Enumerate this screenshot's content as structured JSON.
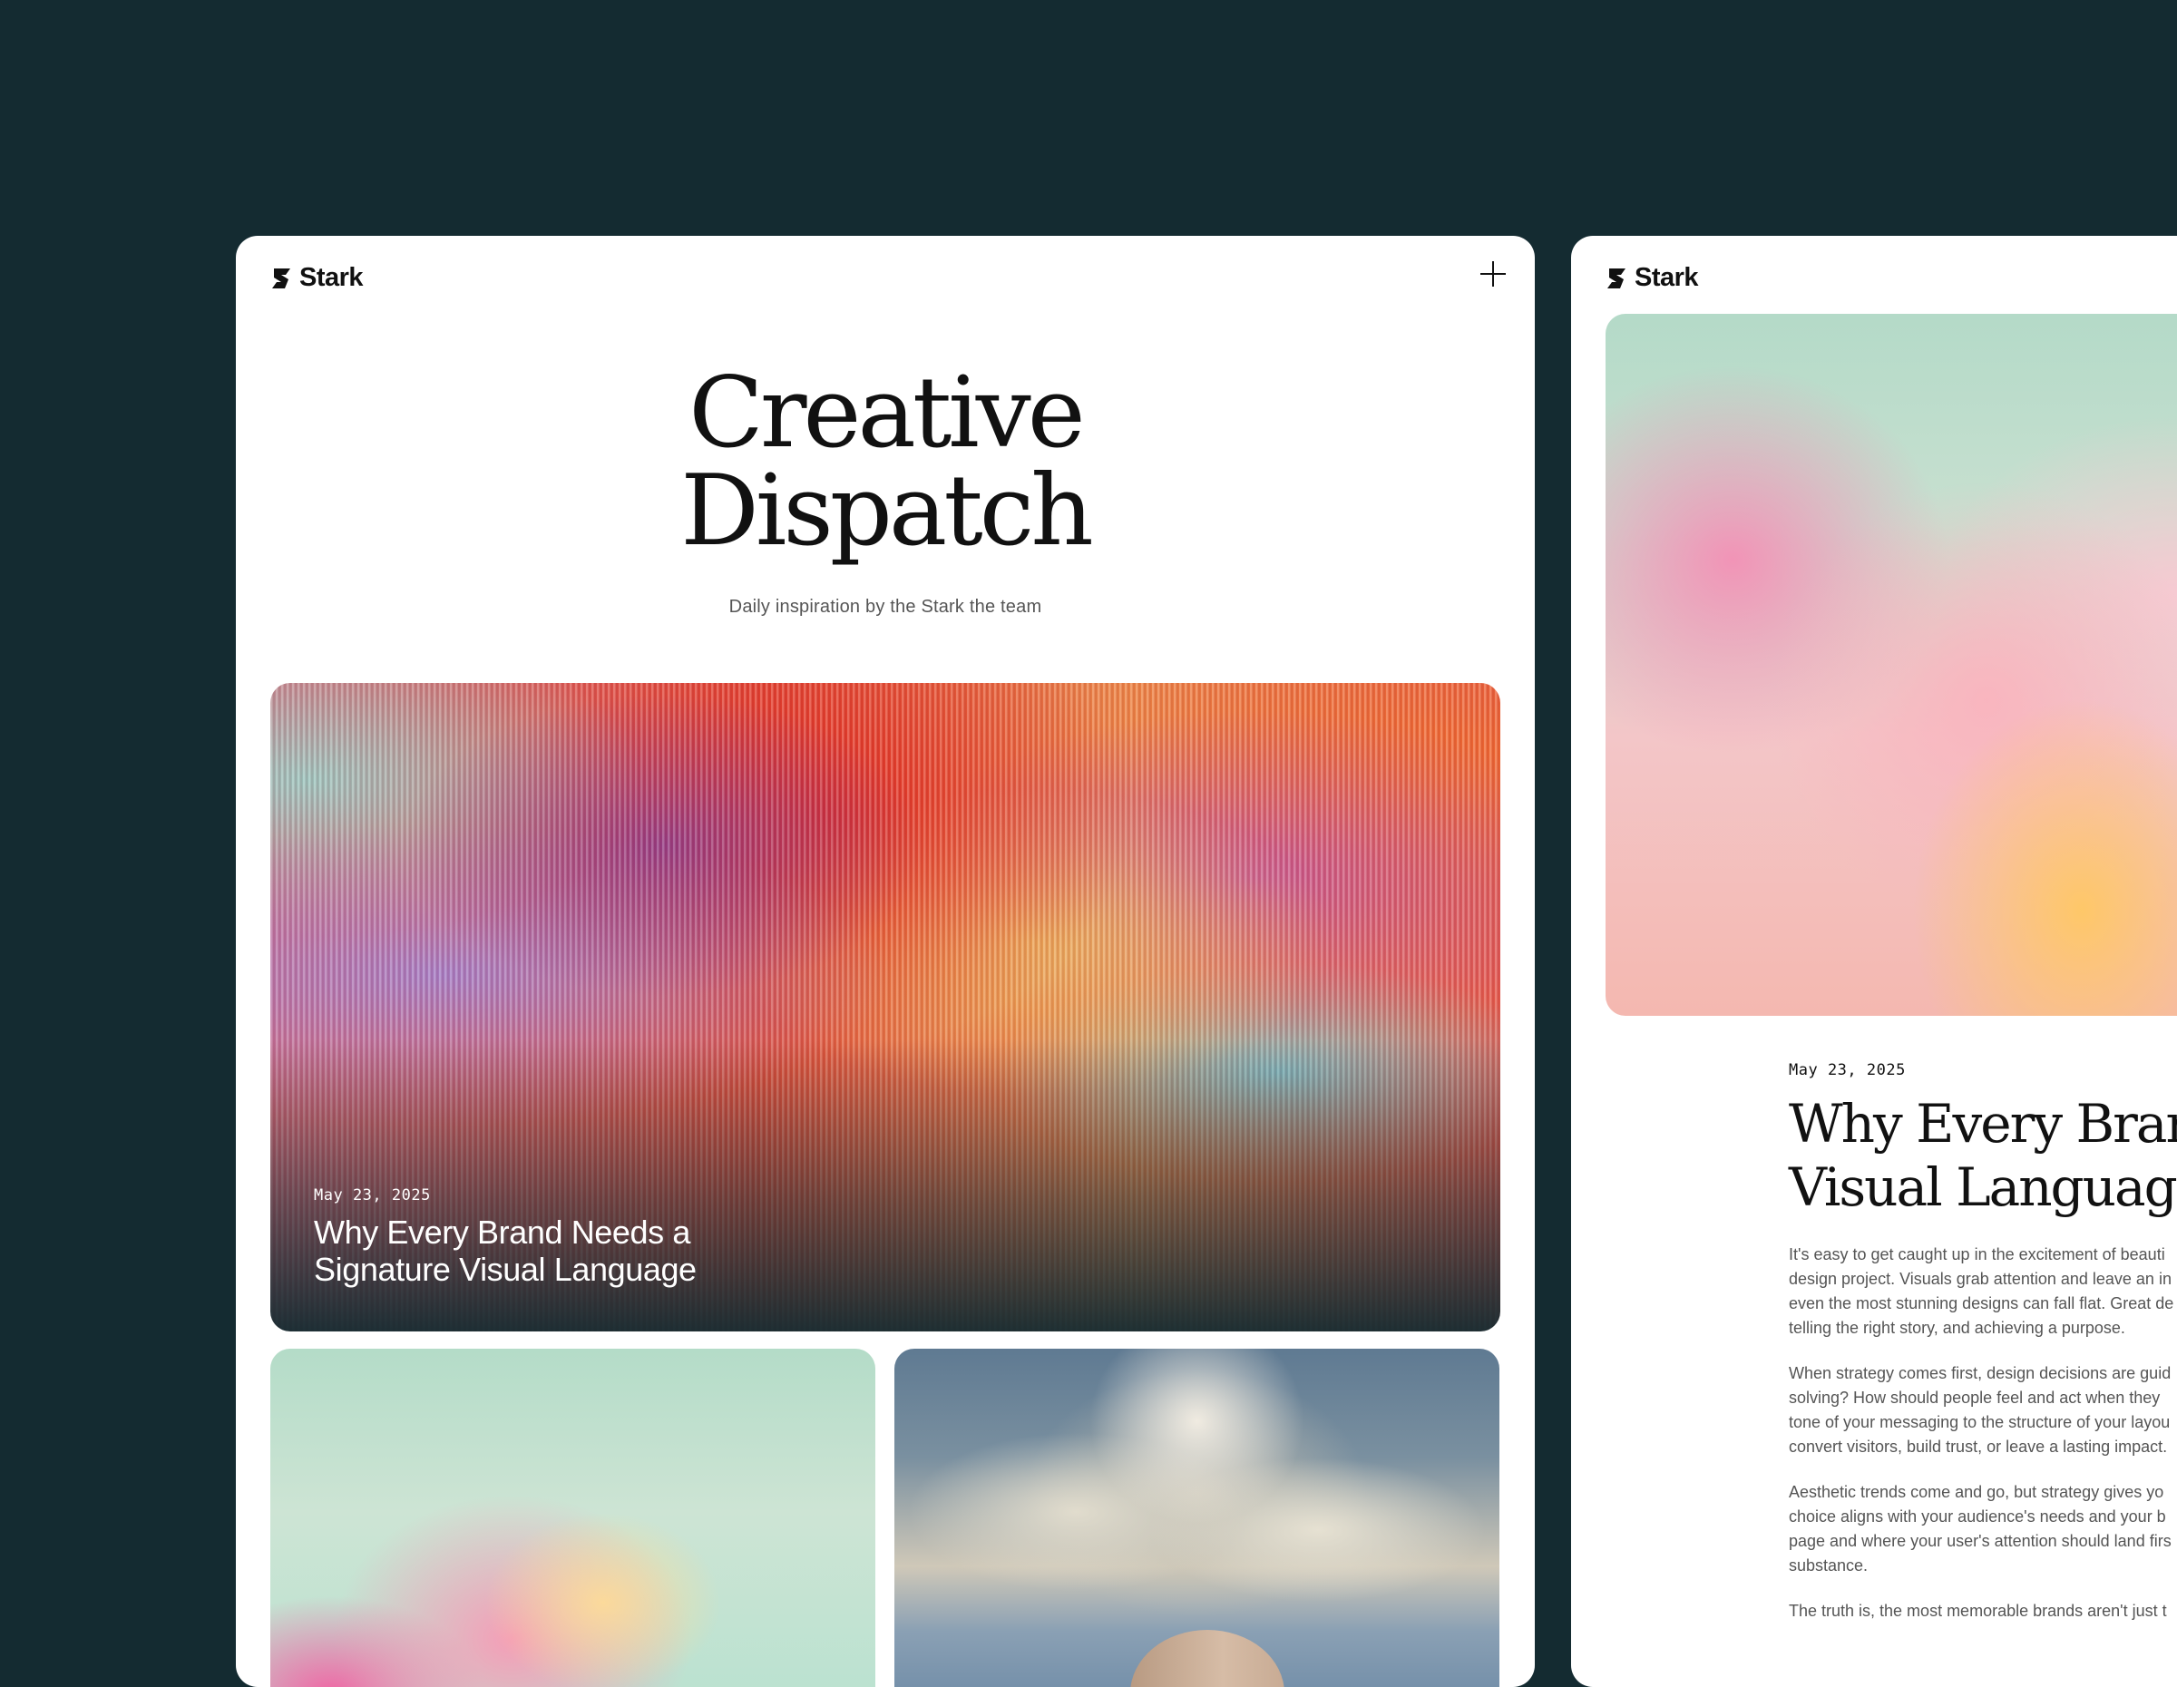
{
  "brand": {
    "name": "Stark"
  },
  "left_card": {
    "title_line1": "Creative",
    "title_line2": "Dispatch",
    "subtitle": "Daily inspiration by the Stark the team",
    "featured": {
      "date": "May 23, 2025",
      "title": "Why Every Brand Needs a Signature Visual Language"
    }
  },
  "right_card": {
    "date": "May 23, 2025",
    "title_line1": "Why Every Bran",
    "title_line2": "Visual Language",
    "paragraphs": [
      "It's easy to get caught up in the excitement of beauti\ndesign project. Visuals grab attention and leave an in\neven the most stunning designs can fall flat. Great de\ntelling the right story, and achieving a purpose.",
      "When strategy comes first, design decisions are guid\nsolving? How should people feel and act when they\ntone of your messaging to the structure of your layou\nconvert visitors, build trust, or leave a lasting impact.",
      "Aesthetic trends come and go, but strategy gives yo\nchoice aligns with your audience's needs and your b\npage and where your user's attention should land firs\nsubstance.",
      "The truth is, the most memorable brands aren't just t"
    ]
  },
  "colors": {
    "background": "#142b31",
    "card": "#ffffff",
    "text": "#111111",
    "muted_text": "#555555"
  },
  "icons": [
    "stark-logo-icon",
    "plus-icon"
  ]
}
